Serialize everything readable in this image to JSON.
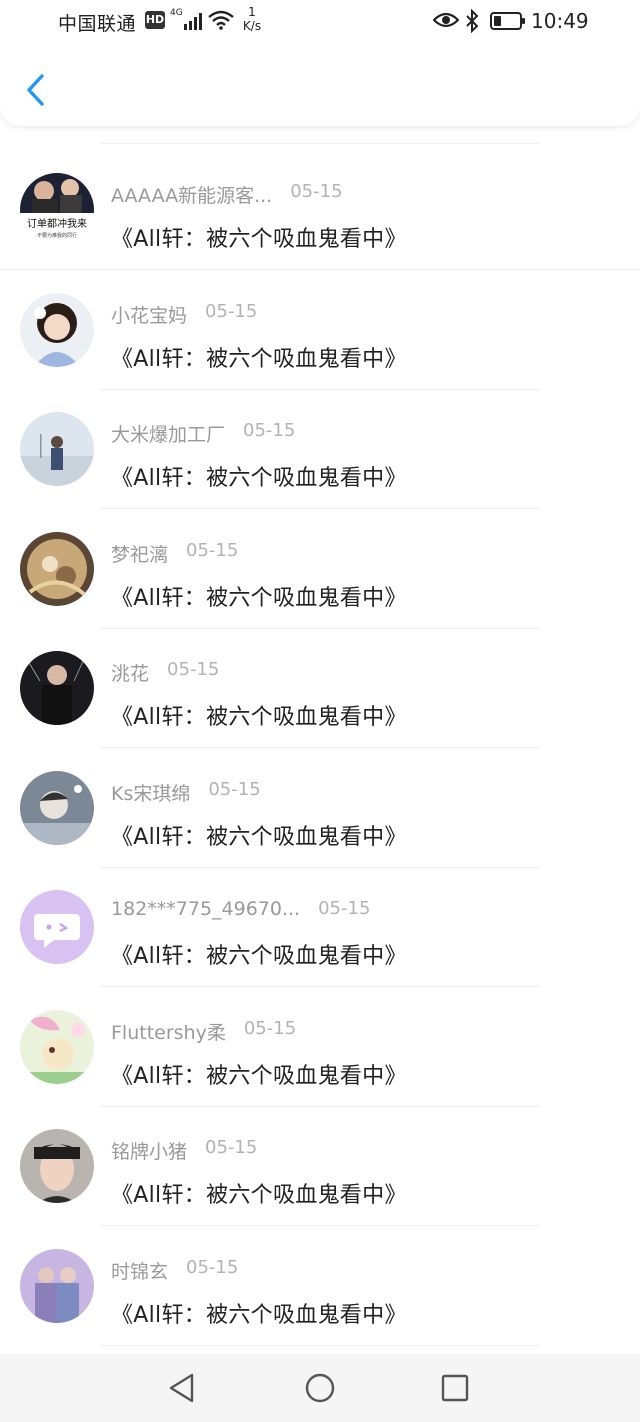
{
  "status_bar": {
    "carrier": "中国联通",
    "hd": "HD",
    "network": "4G",
    "speed_value": "1",
    "speed_unit": "K/s",
    "time": "10:49",
    "battery_level": 0.3
  },
  "icons": {
    "back": "chevron-left-icon",
    "eye": "eye-icon",
    "bluetooth": "bluetooth-icon",
    "nav_back": "triangle-back-icon",
    "nav_home": "circle-home-icon",
    "nav_recent": "square-recent-icon"
  },
  "colors": {
    "accent": "#2196f3",
    "username": "#9a9a9a",
    "date": "#b3b3b3",
    "message": "#222222"
  },
  "messages": [
    {
      "user": "AAAAA新能源客...",
      "date": "05-15",
      "text": "《All轩：被六个吸血鬼看中》",
      "avatar": "avatar-meme"
    },
    {
      "user": "小花宝妈",
      "date": "05-15",
      "text": "《All轩：被六个吸血鬼看中》",
      "avatar": "avatar-girl"
    },
    {
      "user": "大米爆加工厂",
      "date": "05-15",
      "text": "《All轩：被六个吸血鬼看中》",
      "avatar": "avatar-sky"
    },
    {
      "user": "梦祀漓",
      "date": "05-15",
      "text": "《All轩：被六个吸血鬼看中》",
      "avatar": "avatar-art"
    },
    {
      "user": "洮花",
      "date": "05-15",
      "text": "《All轩：被六个吸血鬼看中》",
      "avatar": "avatar-stage"
    },
    {
      "user": "Ks宋琪绵",
      "date": "05-15",
      "text": "《All轩：被六个吸血鬼看中》",
      "avatar": "avatar-snow"
    },
    {
      "user": "182***775_49670...",
      "date": "05-15",
      "text": "《All轩：被六个吸血鬼看中》",
      "avatar": "avatar-default"
    },
    {
      "user": "Fluttershy柔",
      "date": "05-15",
      "text": "《All轩：被六个吸血鬼看中》",
      "avatar": "avatar-pony"
    },
    {
      "user": "铭牌小猪",
      "date": "05-15",
      "text": "《All轩：被六个吸血鬼看中》",
      "avatar": "avatar-portrait"
    },
    {
      "user": "时锦玄",
      "date": "05-15",
      "text": "《All轩：被六个吸血鬼看中》",
      "avatar": "avatar-duo"
    }
  ],
  "avatar_meme_caption": "订单都冲我来",
  "avatar_meme_subcaption": "不要为难我的同行"
}
